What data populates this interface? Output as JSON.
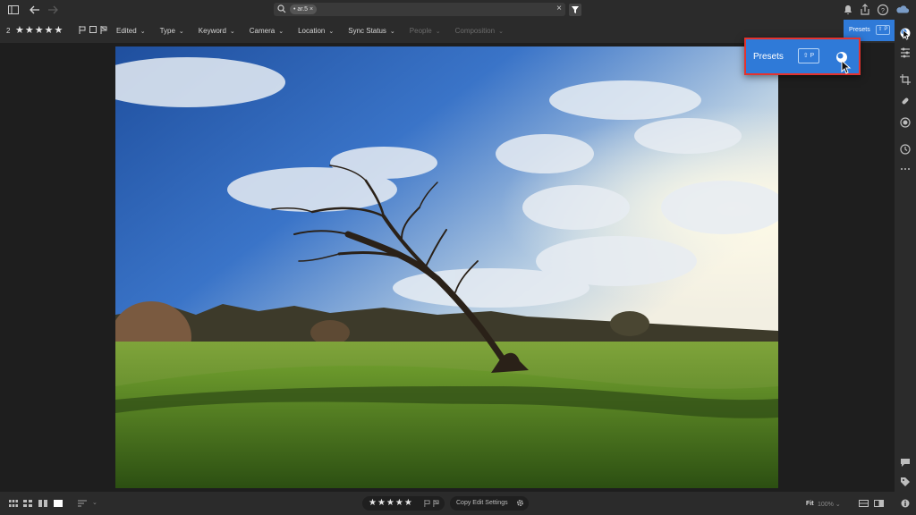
{
  "titlebar": {
    "search_chip": "• ar.5 ×",
    "search_clear": "×"
  },
  "filterbar": {
    "photo_count": "2",
    "stars": "★★★★★",
    "items": [
      {
        "label": "Edited",
        "enabled": true
      },
      {
        "label": "Type",
        "enabled": true
      },
      {
        "label": "Keyword",
        "enabled": true
      },
      {
        "label": "Camera",
        "enabled": true
      },
      {
        "label": "Location",
        "enabled": true
      },
      {
        "label": "Sync Status",
        "enabled": true
      },
      {
        "label": "People",
        "enabled": false
      },
      {
        "label": "Composition",
        "enabled": false
      }
    ],
    "chevron": "⌄"
  },
  "presets_tab": {
    "label": "Presets",
    "shortcut": "⇧ P"
  },
  "popup": {
    "label": "Presets",
    "shortcut": "⇧ P"
  },
  "bottombar": {
    "rating_stars": "★★★★★",
    "copy_label": "Copy Edit Settings",
    "fit_label": "Fit",
    "zoom_label": "100% ⌄"
  },
  "colors": {
    "accent": "#2f7ad8",
    "highlight_border": "#e4332f",
    "chrome": "#2b2b2b",
    "background": "#1e1e1e"
  },
  "icons": [
    "sidebar-toggle-icon",
    "back-arrow-icon",
    "forward-arrow-icon",
    "search-icon",
    "filter-icon",
    "bell-icon",
    "share-icon",
    "help-icon",
    "cloud-icon",
    "presets-icon",
    "edit-sliders-icon",
    "crop-icon",
    "healing-icon",
    "masking-icon",
    "history-icon",
    "more-icon",
    "comment-icon",
    "tag-icon",
    "info-icon"
  ]
}
